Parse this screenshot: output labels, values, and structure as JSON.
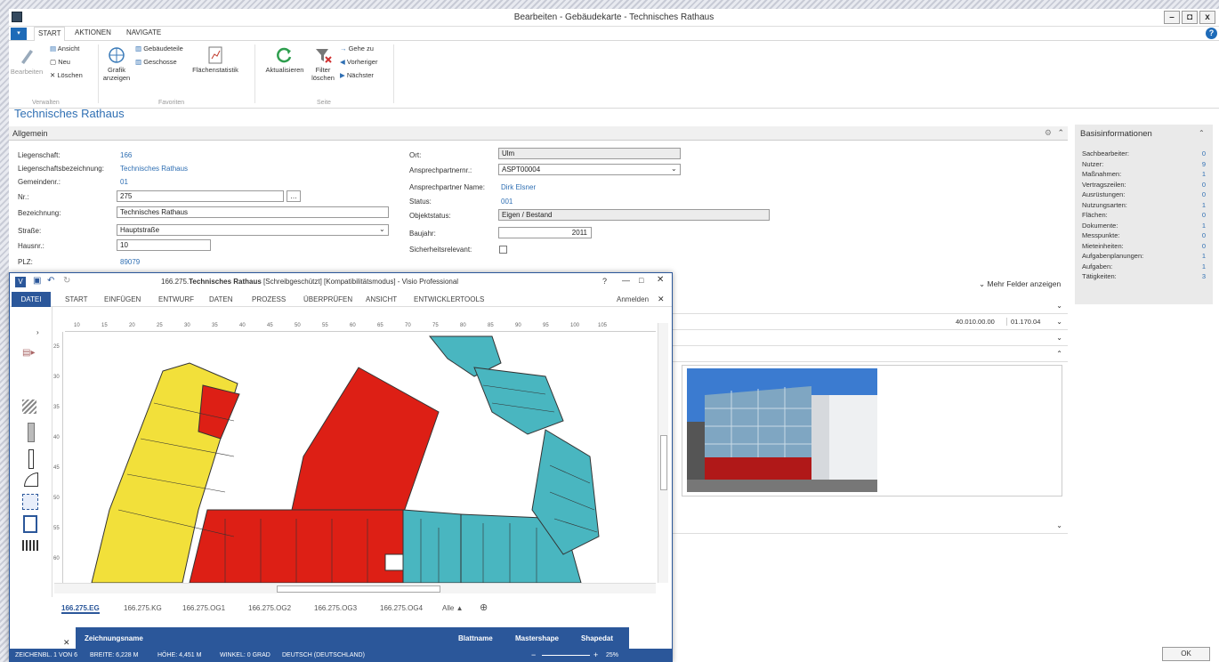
{
  "window": {
    "title": "Bearbeiten - Gebäudekarte - Technisches Rathaus",
    "min": "–",
    "max": "◘",
    "close": "x"
  },
  "tabs": [
    "START",
    "AKTIONEN",
    "NAVIGATE"
  ],
  "ribbon": {
    "bearbeiten": "Bearbeiten",
    "ansicht": "Ansicht",
    "neu": "Neu",
    "loeschen": "Löschen",
    "grafik": "Grafik anzeigen",
    "gebaeudeteile": "Gebäudeteile",
    "geschosse": "Geschosse",
    "flaechenstatistik": "Flächenstatistik",
    "aktualisieren": "Aktualisieren",
    "filter": "Filter löschen",
    "gehe_zu": "Gehe zu",
    "vorheriger": "Vorheriger",
    "naechster": "Nächster",
    "grp_verwalten": "Verwalten",
    "grp_favoriten": "Favoriten",
    "grp_seite": "Seite"
  },
  "page_title": "Technisches Rathaus",
  "section": "Allgemein",
  "fields": {
    "liegenschaft_l": "Liegenschaft:",
    "liegenschaft_v": "166",
    "liegenschaftsbez_l": "Liegenschaftsbezeichnung:",
    "liegenschaftsbez_v": "Technisches Rathaus",
    "gemeindenr_l": "Gemeindenr.:",
    "gemeindenr_v": "01",
    "nr_l": "Nr.:",
    "nr_v": "275",
    "bezeichnung_l": "Bezeichnung:",
    "bezeichnung_v": "Technisches Rathaus",
    "strasse_l": "Straße:",
    "strasse_v": "Hauptstraße",
    "hausnr_l": "Hausnr.:",
    "hausnr_v": "10",
    "plz_l": "PLZ:",
    "plz_v": "89079",
    "ort_l": "Ort:",
    "ort_v": "Ulm",
    "ansprechnr_l": "Ansprechpartnernr.:",
    "ansprechnr_v": "ASPT00004",
    "ansprechname_l": "Ansprechpartner Name:",
    "ansprechname_v": "Dirk Elsner",
    "status_l": "Status:",
    "status_v": "001",
    "objektstatus_l": "Objektstatus:",
    "objektstatus_v": "Eigen / Bestand",
    "baujahr_l": "Baujahr:",
    "baujahr_v": "2011",
    "sicherheit_l": "Sicherheitsrelevant:"
  },
  "more_fields": "Mehr Felder anzeigen",
  "values_row": {
    "a": "40.010.00.00",
    "b": "01.170.04"
  },
  "basis": {
    "title": "Basisinformationen",
    "items": [
      {
        "label": "Sachbearbeiter:",
        "value": "0"
      },
      {
        "label": "Nutzer:",
        "value": "9"
      },
      {
        "label": "Maßnahmen:",
        "value": "1"
      },
      {
        "label": "Vertragszeilen:",
        "value": "0"
      },
      {
        "label": "Ausrüstungen:",
        "value": "0"
      },
      {
        "label": "Nutzungsarten:",
        "value": "1"
      },
      {
        "label": "Flächen:",
        "value": "0"
      },
      {
        "label": "Dokumente:",
        "value": "1"
      },
      {
        "label": "Messpunkte:",
        "value": "0"
      },
      {
        "label": "Mieteinheiten:",
        "value": "0"
      },
      {
        "label": "Aufgabenplanungen:",
        "value": "1"
      },
      {
        "label": "Aufgaben:",
        "value": "1"
      },
      {
        "label": "Tätigkeiten:",
        "value": "3"
      }
    ]
  },
  "visio": {
    "title_pre": "166.275.",
    "title_bold": "Technisches Rathaus",
    "title_post": " [Schreibgeschützt]  [Kompatibilitätsmodus]  - Visio Professional",
    "tabs": [
      "DATEI",
      "START",
      "EINFÜGEN",
      "ENTWURF",
      "DATEN",
      "PROZESS",
      "ÜBERPRÜFEN",
      "ANSICHT",
      "ENTWICKLERTOOLS"
    ],
    "anmelden": "Anmelden",
    "help": "?",
    "pages": [
      "166.275.EG",
      "166.275.KG",
      "166.275.OG1",
      "166.275.OG2",
      "166.275.OG3",
      "166.275.OG4",
      "Alle ▲"
    ],
    "cols": {
      "zeichnungsname": "Zeichnungsname",
      "blattname": "Blattname",
      "mastershape": "Mastershape",
      "shapedat": "Shapedat"
    },
    "status": {
      "page": "ZEICHENBL. 1 VON 6",
      "breite": "BREITE: 6,228 M",
      "hoehe": "HÖHE: 4,451 M",
      "winkel": "WINKEL: 0 GRAD",
      "sprache": "DEUTSCH (DEUTSCHLAND)",
      "zoom": "25%"
    },
    "ruler_top": [
      "10",
      "15",
      "20",
      "25",
      "30",
      "35",
      "40",
      "45",
      "50",
      "55",
      "60",
      "65",
      "70",
      "75",
      "80",
      "85",
      "90",
      "95",
      "100",
      "105"
    ],
    "ruler_left": [
      "25",
      "30",
      "35",
      "40",
      "45",
      "50",
      "55",
      "60"
    ]
  },
  "ok": "OK"
}
